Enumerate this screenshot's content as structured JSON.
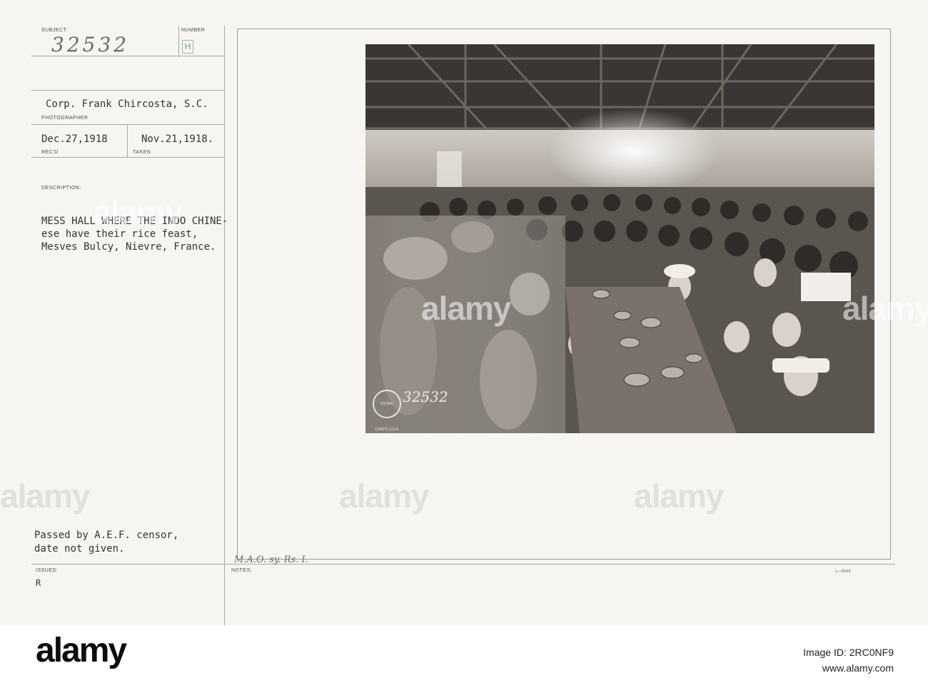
{
  "card": {
    "subject_label": "SUBJECT:",
    "subject_value": "32532",
    "number_label": "NUMBER",
    "number_value": "H",
    "photographer_value": "Corp. Frank Chircosta, S.C.",
    "photographer_label": "PHOTOGRAPHER",
    "received_value": "Dec.27,1918",
    "received_label": "REC'D",
    "taken_value": "Nov.21,1918.",
    "taken_label": "TAKEN",
    "description_label": "DESCRIPTION:",
    "description_lines": [
      "MESS HALL WHERE THE INDO CHINE-",
      "ese have their rice feast,",
      "Mesves Bulcy, Nievre, France."
    ],
    "censor_lines": [
      "Passed by A.E.F. censor,",
      "date not given."
    ],
    "issued_label": "ISSUED:",
    "issued_value": "R",
    "notes_label": "NOTES:",
    "notes_value": "M.A.O. sy. Rs. I.",
    "form_code": "1—5005"
  },
  "photo": {
    "stamp_number": "32532",
    "stamp_seal": "SIGNAL CORPS U.S.A."
  },
  "watermarks": [
    "alamy",
    "alamy",
    "alamy",
    "alamy",
    "alamy",
    "alamy"
  ],
  "footer": {
    "logo": "alamy",
    "image_id_label": "Image ID: 2RC0NF9",
    "url": "www.alamy.com"
  }
}
